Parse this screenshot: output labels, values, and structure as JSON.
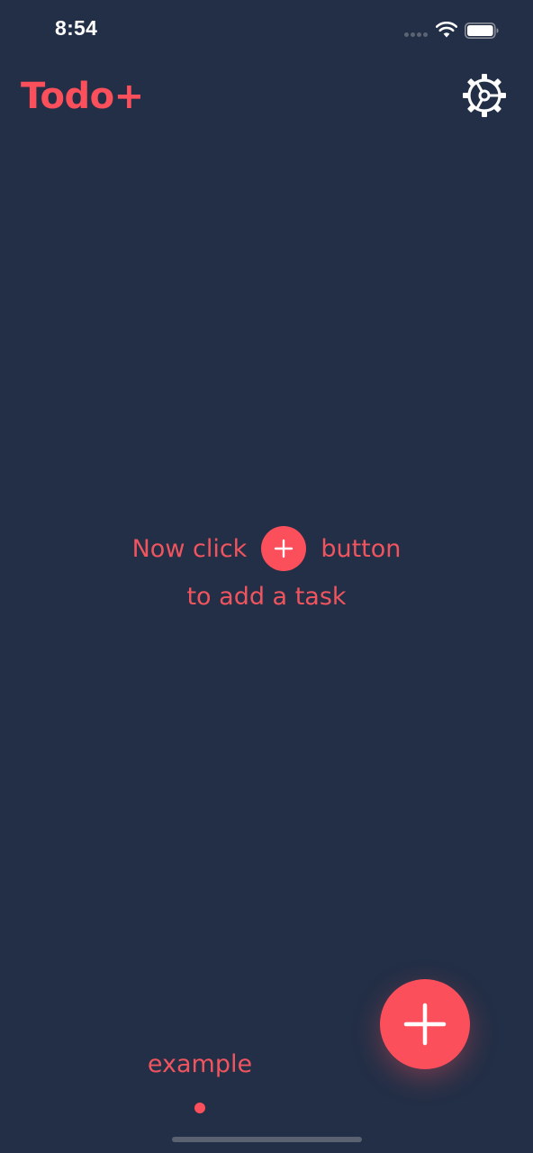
{
  "status_bar": {
    "time": "8:54"
  },
  "header": {
    "title": "Todo+",
    "settings_icon": "gear-icon"
  },
  "empty_state": {
    "line1_before": "Now click",
    "line1_after": "button",
    "line2": "to add a task",
    "inline_icon": "plus-icon"
  },
  "tabs": [
    {
      "label": "example",
      "active": true
    }
  ],
  "fab": {
    "icon": "plus-icon"
  },
  "colors": {
    "background": "#222f46",
    "accent": "#fb4f5c",
    "text_accent": "#f0555f",
    "icon_light": "#ffffff"
  }
}
